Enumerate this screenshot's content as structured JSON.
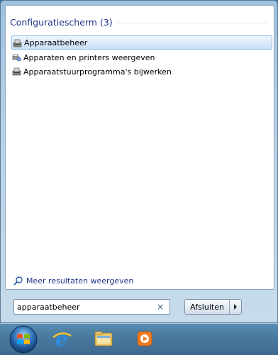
{
  "results": {
    "group_title": "Configuratiescherm (3)",
    "items": [
      {
        "label": "Apparaatbeheer",
        "icon": "device-manager-icon",
        "selected": true
      },
      {
        "label": "Apparaten en printers weergeven",
        "icon": "devices-printers-icon",
        "selected": false
      },
      {
        "label": "Apparaatstuurprogramma's bijwerken",
        "icon": "device-driver-icon",
        "selected": false
      }
    ],
    "more_results_label": "Meer resultaten weergeven"
  },
  "search": {
    "value": "apparaatbeheer",
    "clear_symbol": "×"
  },
  "shutdown": {
    "label": "Afsluiten"
  },
  "taskbar": {
    "items": [
      {
        "name": "start-orb",
        "icon": "windows-logo-icon"
      },
      {
        "name": "internet-explorer",
        "icon": "internet-explorer-icon"
      },
      {
        "name": "windows-explorer",
        "icon": "folder-icon"
      },
      {
        "name": "media-player",
        "icon": "media-player-icon"
      }
    ]
  },
  "colors": {
    "group_title": "#1e3287",
    "selection_border": "#8fbfe8",
    "taskbar": "#4a7aa0"
  }
}
